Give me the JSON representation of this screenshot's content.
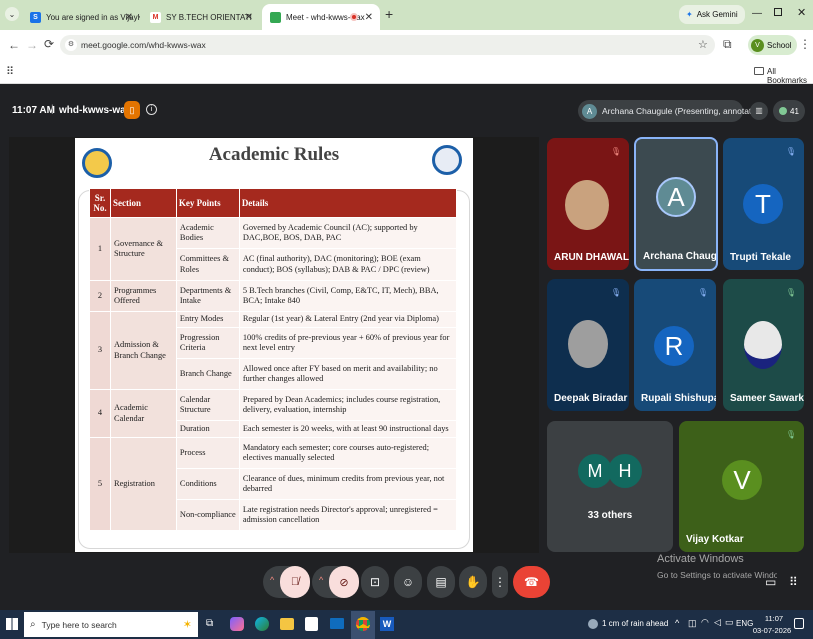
{
  "browser": {
    "tabs": [
      {
        "label": "You are signed in as VijayKotkar",
        "icon": "signin-icon",
        "color": "#1a73e8"
      },
      {
        "label": "SY B.TECH ORIENTATION MEET",
        "icon": "gmail-icon",
        "color": "#d93025"
      },
      {
        "label": "Meet - whd-kwws-wax",
        "icon": "meet-icon",
        "color": "#34a853"
      }
    ],
    "new_tab": "+",
    "ask_gemini": "Ask Gemini",
    "url": "meet.google.com/whd-kwws-wax",
    "profile": "School",
    "all_bookmarks": "All Bookmarks"
  },
  "meet": {
    "time": "11:07 AM",
    "separator": "|",
    "code": "whd-kwws-wax",
    "presenter": "Archana Chaugule (Presenting, annotating)",
    "presenter_initial": "A",
    "participant_count": "41",
    "tiles": [
      {
        "name": "ARUN DHAWALE",
        "kind": "photo",
        "bg": "#7a1515"
      },
      {
        "name": "Archana Chaug...",
        "initial": "A",
        "kind": "avatar",
        "bg": "#3c4a50",
        "circle": "#5f8b94"
      },
      {
        "name": "Trupti Tekale",
        "initial": "T",
        "kind": "avatar",
        "bg": "#174a78",
        "circle": "#1565c0"
      },
      {
        "name": "Deepak Biradar",
        "kind": "photo",
        "bg": "#0e2e4e"
      },
      {
        "name": "Rupali Shishupal",
        "initial": "R",
        "kind": "avatar",
        "bg": "#174a78",
        "circle": "#1565c0"
      },
      {
        "name": "Sameer Sawark...",
        "kind": "photo",
        "bg": "#1d4b48"
      },
      {
        "name": "33 others",
        "initials": [
          "M",
          "H"
        ],
        "kind": "group",
        "bg": "#3c4043"
      },
      {
        "name": "Vijay Kotkar",
        "initial": "V",
        "kind": "avatar",
        "bg": "#3d6019",
        "circle": "#5a8f1f"
      }
    ],
    "activate_windows_title": "Activate Windows",
    "activate_windows_sub": "Go to Settings to activate Windows."
  },
  "slide": {
    "title": "Academic Rules",
    "headers": [
      "Sr. No.",
      "Section",
      "Key Points",
      "Details"
    ],
    "rows": [
      {
        "no": "1",
        "section": "Governance & Structure",
        "points": [
          {
            "key": "Academic Bodies",
            "detail": "Governed by Academic Council (AC); supported by DAC,BOE, BOS, DAB, PAC"
          },
          {
            "key": "Committees & Roles",
            "detail": "AC (final authority), DAC (monitoring); BOE (exam conduct); BOS (syllabus); DAB & PAC / DPC (review)"
          }
        ]
      },
      {
        "no": "2",
        "section": "Programmes Offered",
        "points": [
          {
            "key": "Departments & Intake",
            "detail": "5 B.Tech branches (Civil, Comp, E&TC, IT, Mech), BBA, BCA; Intake 840"
          }
        ]
      },
      {
        "no": "3",
        "section": "Admission & Branch Change",
        "points": [
          {
            "key": "Entry Modes",
            "detail": "Regular (1st year) & Lateral Entry (2nd year via Diploma)"
          },
          {
            "key": "Progression Criteria",
            "detail": "100% credits of pre-previous year + 60% of previous year for next level entry"
          },
          {
            "key": "Branch Change",
            "detail": "Allowed once after FY based on merit and availability; no further changes allowed"
          }
        ]
      },
      {
        "no": "4",
        "section": "Academic Calendar",
        "points": [
          {
            "key": "Calendar Structure",
            "detail": "Prepared by Dean Academics; includes course registration, delivery, evaluation, internship"
          },
          {
            "key": "Duration",
            "detail": "Each semester is 20 weeks, with at least 90 instructional days"
          }
        ]
      },
      {
        "no": "5",
        "section": "Registration",
        "points": [
          {
            "key": "Process",
            "detail": "Mandatory each semester; core courses auto-registered; electives manually selected"
          },
          {
            "key": "Conditions",
            "detail": "Clearance of dues, minimum credits from previous year, not debarred"
          },
          {
            "key": "Non-compliance",
            "detail": "Late registration needs Director's approval; unregistered = admission cancellation"
          }
        ]
      }
    ]
  },
  "taskbar": {
    "search_placeholder": "Type here to search",
    "weather": "1 cm of rain ahead",
    "lang": "ENG",
    "time": "11:07",
    "date": "03-07-2026"
  },
  "colors": {
    "header_red": "#a5291e",
    "meet_bg": "#202124",
    "leave_red": "#ea4335",
    "tab_green": "#cfe3c4"
  }
}
